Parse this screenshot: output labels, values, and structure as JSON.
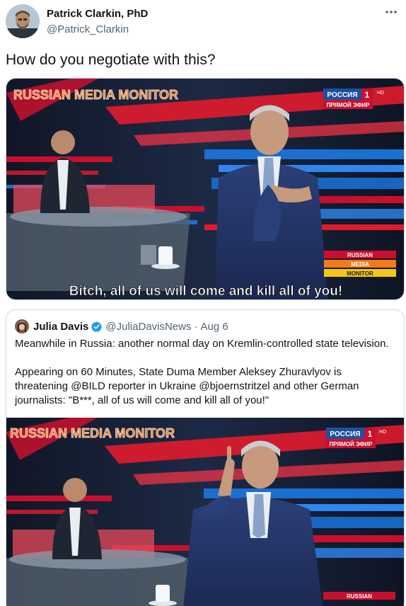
{
  "tweet": {
    "author_name": "Patrick Clarkin, PhD",
    "author_handle": "@Patrick_Clarkin",
    "text": "How do you negotiate with this?",
    "more_icon": "more-horizontal-icon"
  },
  "video1": {
    "watermark": "RUSSIAN MEDIA MONITOR",
    "channel_name": "РОССИЯ",
    "channel_number": "1",
    "channel_hd": "HD",
    "live_label": "ПРЯМОЙ ЭФИР",
    "badge_lines": [
      "RUSSIAN",
      "MEDIA",
      "MONITOR"
    ],
    "subtitle": "Bitch, all of us will come and kill all of you!"
  },
  "quote": {
    "author_name": "Julia Davis",
    "verified_icon": "verified-badge-icon",
    "author_handle": "@JuliaDavisNews",
    "separator": "·",
    "date": "Aug 6",
    "paragraph1": "Meanwhile in Russia: another normal day on Kremlin-controlled state television.",
    "paragraph2": "Appearing on 60 Minutes, State Duma Member Aleksey Zhuravlyov is threatening @BILD reporter in Ukraine @bjoernstritzel and other German journalists: \"B***, all of us will come and kill all of you!\""
  },
  "video2": {
    "watermark": "RUSSIAN MEDIA MONITOR",
    "channel_name": "РОССИЯ",
    "channel_number": "1",
    "channel_hd": "HD",
    "live_label": "ПРЯМОЙ ЭФИР",
    "badge_first": "RUSSIAN"
  },
  "colors": {
    "verified": "#1d9bf0",
    "muted_text": "#536471",
    "studio_red": "#c8102e",
    "studio_blue": "#1a6fd1"
  }
}
